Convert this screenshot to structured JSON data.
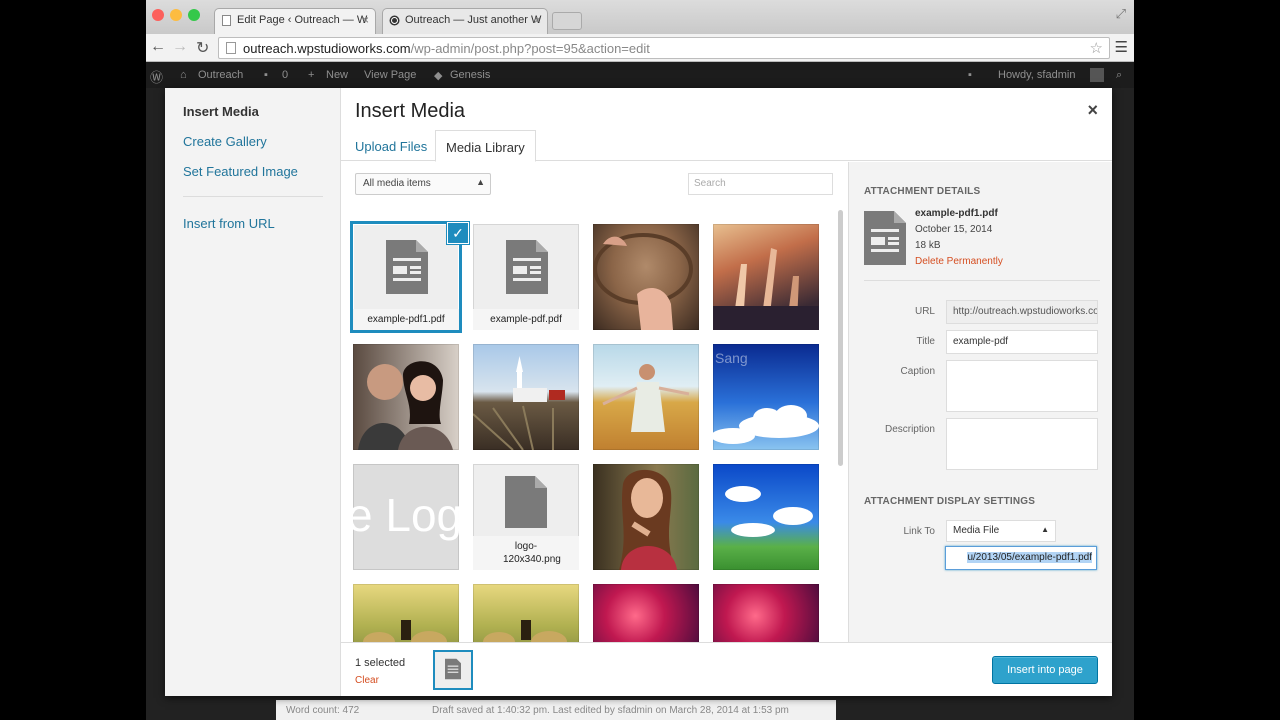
{
  "browser": {
    "tabs": [
      {
        "title": "Edit Page ‹ Outreach — W"
      },
      {
        "title": "Outreach — Just another W"
      }
    ],
    "url_host": "outreach.wpstudioworks.com",
    "url_path": "/wp-admin/post.php?post=95&action=edit"
  },
  "adminbar": {
    "site": "Outreach",
    "comments": "0",
    "new": "New",
    "view": "View Page",
    "genesis": "Genesis",
    "howdy": "Howdy, sfadmin"
  },
  "status": {
    "word_count": "Word count: 472",
    "draft": "Draft saved at 1:40:32 pm. Last edited by sfadmin on March 28, 2014 at 1:53 pm"
  },
  "modal": {
    "title": "Insert Media",
    "close": "×",
    "menu": [
      "Insert Media",
      "Create Gallery",
      "Set Featured Image",
      "Insert from URL"
    ],
    "router": [
      "Upload Files",
      "Media Library"
    ],
    "filter": "All media items",
    "search_placeholder": "Search",
    "attachments": [
      {
        "type": "doc",
        "name": "example-pdf1.pdf",
        "selected": true
      },
      {
        "type": "doc",
        "name": "example-pdf.pdf"
      },
      {
        "type": "image",
        "subject": "hands on drum"
      },
      {
        "type": "image",
        "subject": "crowd with raised hands"
      },
      {
        "type": "image",
        "subject": "couple portrait"
      },
      {
        "type": "image",
        "subject": "church on farmland"
      },
      {
        "type": "image",
        "subject": "girl in wheat field"
      },
      {
        "type": "image",
        "subject": "sky with clouds"
      },
      {
        "type": "image",
        "subject": "logo placeholder"
      },
      {
        "type": "doc",
        "name": "logo-120x340.png"
      },
      {
        "type": "image",
        "subject": "woman portrait"
      },
      {
        "type": "image",
        "subject": "blue sky over green field"
      },
      {
        "type": "image",
        "subject": "hay bales at sunset"
      },
      {
        "type": "image",
        "subject": "hay bales at sunset"
      },
      {
        "type": "image",
        "subject": "concert lights"
      },
      {
        "type": "image",
        "subject": "concert lights"
      }
    ],
    "logo_text": "e Log",
    "sky_text": "Sang",
    "details": {
      "heading": "Attachment Details",
      "filename": "example-pdf1.pdf",
      "date": "October 15, 2014",
      "size": "18 kB",
      "delete": "Delete Permanently",
      "url_label": "URL",
      "url_value": "http://outreach.wpstudioworks.com",
      "title_label": "Title",
      "title_value": "example-pdf",
      "caption_label": "Caption",
      "description_label": "Description",
      "display_heading": "Attachment Display Settings",
      "linkto_label": "Link To",
      "linkto_value": "Media File",
      "link_url": "u/2013/05/example-pdf1.pdf"
    },
    "toolbar": {
      "selected": "1 selected",
      "clear": "Clear",
      "insert": "Insert into page"
    }
  },
  "colors": {
    "accent": "#1e8cbe",
    "button": "#2ea2cc",
    "danger": "#d54e21",
    "link": "#21759b"
  }
}
